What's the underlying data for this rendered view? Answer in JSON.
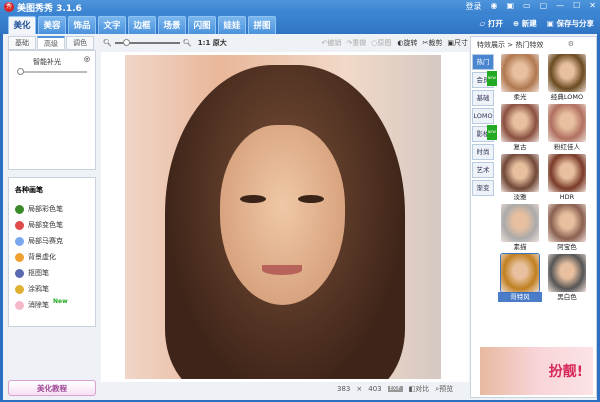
{
  "app": {
    "title": "美图秀秀 3.1.6",
    "logo_text": "秀",
    "login": "登录"
  },
  "main_tabs": [
    "美化",
    "美容",
    "饰品",
    "文字",
    "边框",
    "场景",
    "闪图",
    "娃娃",
    "拼图"
  ],
  "top_actions": {
    "open": "打开",
    "new": "新建",
    "save": "保存与分享"
  },
  "left": {
    "sub_tabs": [
      "基础",
      "高级",
      "调色"
    ],
    "smart_fill_label": "智能补光",
    "smart_fill_value": 0,
    "brush_title": "各种画笔",
    "brushes": [
      {
        "label": "局部彩色笔",
        "color": "#3a8a2a"
      },
      {
        "label": "局部变色笔",
        "color": "#e04a4a"
      },
      {
        "label": "局部马赛克",
        "color": "#7aa8f0"
      },
      {
        "label": "背景虚化",
        "color": "#f0a030"
      },
      {
        "label": "抠图笔",
        "color": "#5a6ab0"
      },
      {
        "label": "涂鸦笔",
        "color": "#e0b030"
      },
      {
        "label": "消除笔",
        "color": "#f4b8c8",
        "badge": "New"
      }
    ],
    "tutorial": "美化教程"
  },
  "toolbar": {
    "zoom_value": 0.15,
    "actual_size": "1:1 原大",
    "undo": "撤销",
    "redo": "重做",
    "original": "原图",
    "rotate": "旋转",
    "crop": "裁剪",
    "resize": "尺寸"
  },
  "status": {
    "width": "383",
    "x": "×",
    "height": "403",
    "exif": "EXIF",
    "compare": "对比",
    "preview": "预览"
  },
  "right": {
    "breadcrumb": "特效展示 > 热门特效",
    "categories": [
      {
        "label": "热门"
      },
      {
        "label": "会员",
        "badge": "NEW"
      },
      {
        "label": "基础"
      },
      {
        "label": "LOMO"
      },
      {
        "label": "影楼",
        "badge": "NEW"
      },
      {
        "label": "时尚"
      },
      {
        "label": "艺术"
      },
      {
        "label": "渐变"
      }
    ],
    "effects": [
      {
        "label": "柔光",
        "tint": "#b07850"
      },
      {
        "label": "经典LOMO",
        "tint": "#6a4a20"
      },
      {
        "label": "复古",
        "tint": "#8a5040"
      },
      {
        "label": "粉红佳人",
        "tint": "#b07060"
      },
      {
        "label": "淡雅",
        "tint": "#704838"
      },
      {
        "label": "HDR",
        "tint": "#7a3a28"
      },
      {
        "label": "素描",
        "tint": "#aaaaaa"
      },
      {
        "label": "阿宝色",
        "tint": "#8a6050"
      },
      {
        "label": "哥特风",
        "tint": "#c08020",
        "selected": true
      },
      {
        "label": "黑白色",
        "tint": "#555555"
      }
    ],
    "ad_text": "扮靓!"
  }
}
